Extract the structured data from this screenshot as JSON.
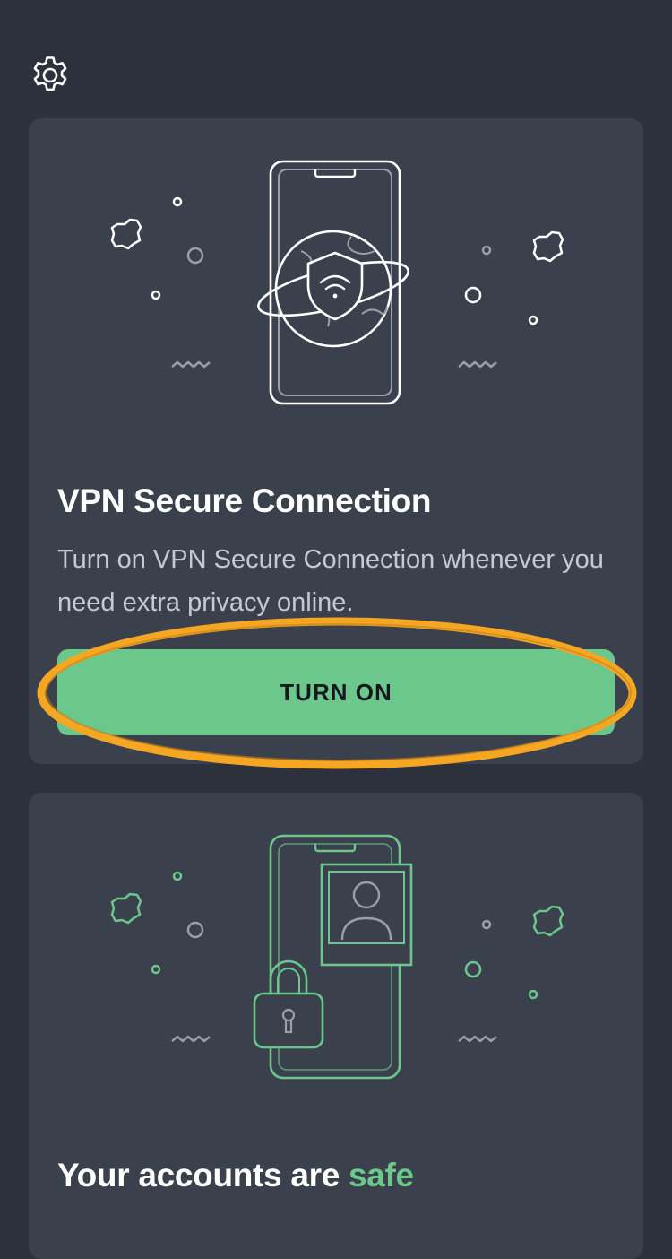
{
  "header": {
    "settings_icon": "gear-icon"
  },
  "vpn_card": {
    "title": "VPN Secure Connection",
    "description": "Turn on VPN Secure Connection whenever you need extra privacy online.",
    "button_label": "TURN ON",
    "illustration_icon": "phone-globe-shield-icon"
  },
  "accounts_card": {
    "title_prefix": "Your accounts are ",
    "title_accent": "safe",
    "illustration_icon": "phone-profile-lock-icon"
  },
  "colors": {
    "background": "#2d313b",
    "card": "#3b404d",
    "accent_green": "#6cc78c",
    "highlight_orange": "#f5a623"
  }
}
